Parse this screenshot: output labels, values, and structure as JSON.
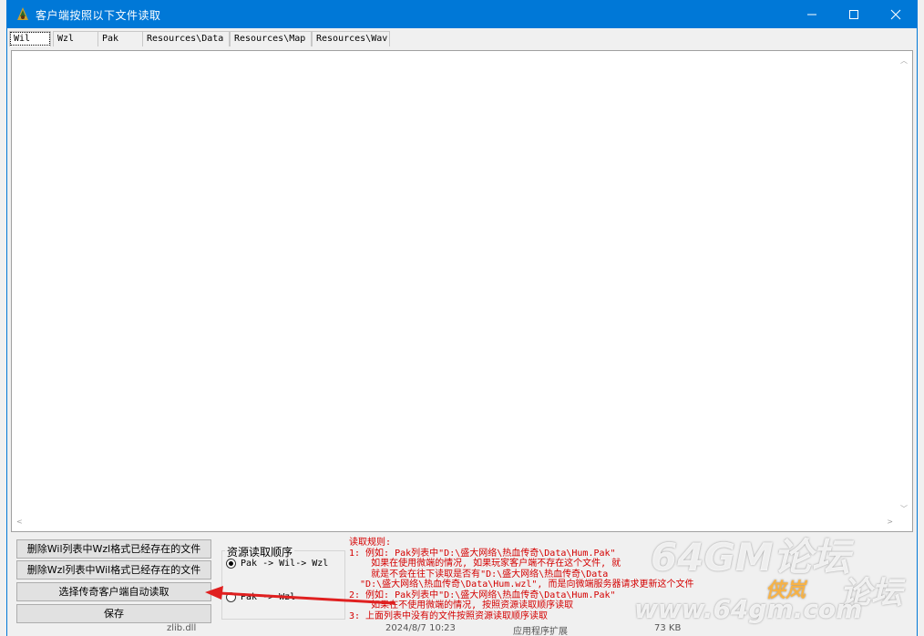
{
  "window": {
    "title": "客户端按照以下文件读取"
  },
  "tabs": [
    "Wil",
    "Wzl",
    "Pak",
    "Resources\\Data",
    "Resources\\Map",
    "Resources\\Wav"
  ],
  "buttons": {
    "delete_wil": "删除Wil列表中Wzl格式已经存在的文件",
    "delete_wzl": "删除Wzl列表中Wil格式已经存在的文件",
    "auto_read": "选择传奇客户端自动读取",
    "save": "保存"
  },
  "resource_order": {
    "title": "资源读取顺序",
    "options": [
      "Pak -> Wil-> Wzl",
      "Pak -> Wzl"
    ],
    "selected_index": 0
  },
  "rules": {
    "heading": "读取规则:",
    "lines": [
      "1: 例如: Pak列表中\"D:\\盛大网络\\热血传奇\\Data\\Hum.Pak\"",
      "    如果在使用微端的情况, 如果玩家客户端不存在这个文件, 就",
      "    就是不会在往下读取是否有\"D:\\盛大网络\\热血传奇\\Data",
      "  \"D:\\盛大网络\\热血传奇\\Data\\Hum.wzl\", 而是向微端服务器请求更新这个文件",
      "2: 例如: Pak列表中\"D:\\盛大网络\\热血传奇\\Data\\Hum.Pak\"",
      "    如果在不使用微端的情况, 按照资源读取顺序读取",
      "3: 上面列表中没有的文件按照资源读取顺序读取"
    ]
  },
  "watermark": {
    "brand": "64GM论坛",
    "url": "www.64gm.com",
    "right": "论坛",
    "logo": "侠岚"
  },
  "background_file": {
    "name": "zlib.dll",
    "date": "2024/8/7 10:23",
    "type": "应用程序扩展",
    "size": "73 KB"
  },
  "colors": {
    "titlebar": "#0078d7",
    "rules_text": "#d40000",
    "annotation_arrow": "#e02020"
  }
}
